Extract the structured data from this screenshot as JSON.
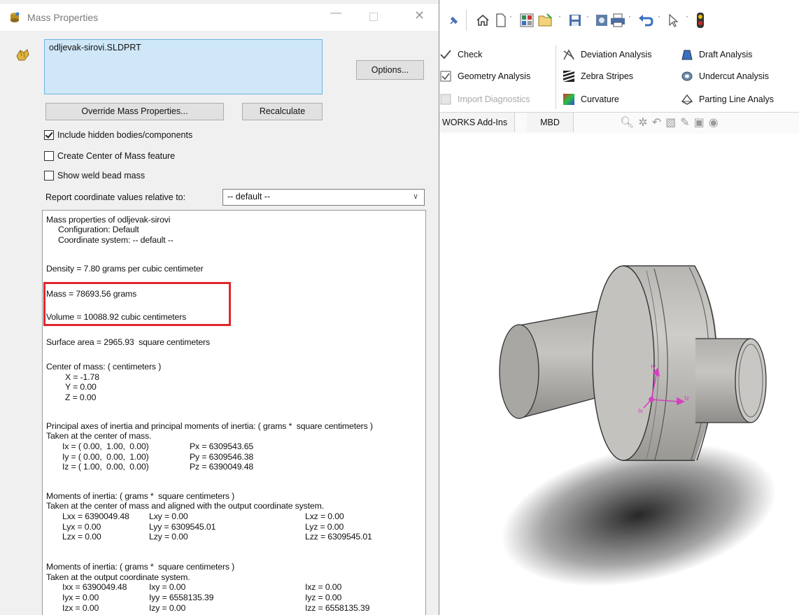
{
  "dialog": {
    "title": "Mass Properties",
    "window_controls": {
      "minimize": "—",
      "close": "✕"
    },
    "selection": "odljevak-sirovi.SLDPRT",
    "options_label": "Options...",
    "override_label": "Override Mass Properties...",
    "recalculate_label": "Recalculate",
    "checkboxes": [
      {
        "label": "Include hidden bodies/components",
        "checked": true
      },
      {
        "label": "Create Center of Mass feature",
        "checked": false
      },
      {
        "label": "Show weld bead mass",
        "checked": false
      }
    ],
    "report_label": "Report coordinate values relative to:",
    "coord_value": "-- default --",
    "results": {
      "header": "Mass properties of odljevak-sirovi",
      "config": "Configuration: Default",
      "coordsys": "Coordinate system: -- default --",
      "density": "Density = 7.80 grams per cubic centimeter",
      "mass": "Mass = 78693.56 grams",
      "volume": "Volume = 10088.92 cubic centimeters",
      "surface": "Surface area = 2965.93  square centimeters",
      "com_title": "Center of mass: ( centimeters )",
      "com": [
        "X = -1.78",
        "Y = 0.00",
        "Z = 0.00"
      ],
      "principal_title": "Principal axes of inertia and principal moments of inertia: ( grams *  square centimeters )",
      "principal_sub": "Taken at the center of mass.",
      "principal_rows": [
        {
          "axis": "Ix = ( 0.00,  1.00,  0.00)",
          "moment": "Px = 6309543.65"
        },
        {
          "axis": "Iy = ( 0.00,  0.00,  1.00)",
          "moment": "Py = 6309546.38"
        },
        {
          "axis": "Iz = ( 1.00,  0.00,  0.00)",
          "moment": "Pz = 6390049.48"
        }
      ],
      "moi1_title": "Moments of inertia: ( grams *  square centimeters )",
      "moi1_sub": "Taken at the center of mass and aligned with the output coordinate system.",
      "moi1_rows": [
        [
          "Lxx = 6390049.48",
          "Lxy = 0.00",
          "Lxz = 0.00"
        ],
        [
          "Lyx = 0.00",
          "Lyy = 6309545.01",
          "Lyz = 0.00"
        ],
        [
          "Lzx = 0.00",
          "Lzy = 0.00",
          "Lzz = 6309545.01"
        ]
      ],
      "moi2_title": "Moments of inertia: ( grams *  square centimeters )",
      "moi2_sub": "Taken at the output coordinate system.",
      "moi2_rows": [
        [
          "Ixx = 6390049.48",
          "Ixy = 0.00",
          "Ixz = 0.00"
        ],
        [
          "Iyx = 0.00",
          "Iyy = 6558135.39",
          "Iyz = 0.00"
        ],
        [
          "Izx = 0.00",
          "Izy = 0.00",
          "Izz = 6558135.39"
        ]
      ]
    }
  },
  "ribbon": {
    "col1": [
      {
        "label": "Check",
        "enabled": true
      },
      {
        "label": "Geometry Analysis",
        "enabled": true
      },
      {
        "label": "Import Diagnostics",
        "enabled": false
      }
    ],
    "col2": [
      {
        "label": "Deviation Analysis"
      },
      {
        "label": "Zebra Stripes"
      },
      {
        "label": "Curvature"
      }
    ],
    "col3": [
      {
        "label": "Draft Analysis"
      },
      {
        "label": "Undercut Analysis"
      },
      {
        "label": "Parting Line Analys"
      }
    ]
  },
  "tabs": [
    "WORKS Add-Ins",
    "MBD"
  ],
  "triad_labels": {
    "x": "Ix",
    "y": "Iy",
    "z": "Iz"
  }
}
